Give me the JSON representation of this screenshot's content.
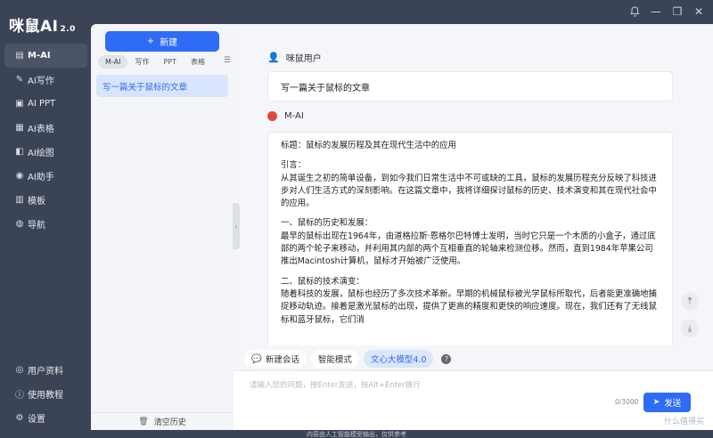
{
  "app": {
    "logo": "咪鼠AI",
    "version": "2.0"
  },
  "titlebar": {
    "bell_icon": "bell-icon",
    "minimize": "—",
    "restore": "❐",
    "close": "✕"
  },
  "nav": {
    "items": [
      {
        "icon": "chat-icon",
        "label": "M-AI",
        "active": true
      },
      {
        "icon": "write-icon",
        "label": "AI写作"
      },
      {
        "icon": "ppt-icon",
        "label": "AI PPT"
      },
      {
        "icon": "sheet-icon",
        "label": "AI表格"
      },
      {
        "icon": "paint-icon",
        "label": "AI绘图"
      },
      {
        "icon": "assistant-icon",
        "label": "AI助手"
      },
      {
        "icon": "template-icon",
        "label": "模板"
      },
      {
        "icon": "compass-icon",
        "label": "导航"
      }
    ],
    "bottom": [
      {
        "icon": "user-icon",
        "label": "用户资料"
      },
      {
        "icon": "help-icon",
        "label": "使用教程"
      },
      {
        "icon": "gear-icon",
        "label": "设置"
      }
    ]
  },
  "history": {
    "new_button": "新建",
    "tabs": [
      "M-AI",
      "写作",
      "PPT",
      "表格"
    ],
    "items": [
      "写一篇关于鼠标的文章"
    ],
    "clear": "清空历史"
  },
  "chat": {
    "user_name": "咪鼠用户",
    "user_message": "写一篇关于鼠标的文章",
    "ai_name": "M-AI",
    "ai_paragraphs": [
      "标题：鼠标的发展历程及其在现代生活中的应用",
      "引言：\n从其诞生之初的简单设备，到如今我们日常生活中不可或缺的工具，鼠标的发展历程充分反映了科技进步对人们生活方式的深刻影响。在这篇文章中，我将详细探讨鼠标的历史、技术演变和其在现代社会中的应用。",
      "一、鼠标的历史和发展：\n最早的鼠标出现在1964年，由道格拉斯·恩格尔巴特博士发明，当时它只是一个木质的小盒子，通过底部的两个轮子来移动，并利用其内部的两个互相垂直的轮轴来检测位移。然而，直到1984年苹果公司推出Macintosh计算机，鼠标才开始被广泛使用。",
      "二、鼠标的技术演变：\n随着科技的发展，鼠标也经历了多次技术革新。早期的机械鼠标被光学鼠标所取代，后者能更准确地捕捉移动轨迹。接着是激光鼠标的出现，提供了更高的精度和更快的响应速度。现在，我们还有了无线鼠标和蓝牙鼠标，它们消"
    ],
    "chips": [
      "新建会话",
      "智能模式",
      "文心大模型4.0"
    ],
    "input_placeholder": "请输入您的问题，按Enter发送，按Alt+Enter换行",
    "counter": "0/3000",
    "send": "发送"
  },
  "footer": "内容由人工智能模型输出，仅供参考",
  "watermark": "什么值得买"
}
